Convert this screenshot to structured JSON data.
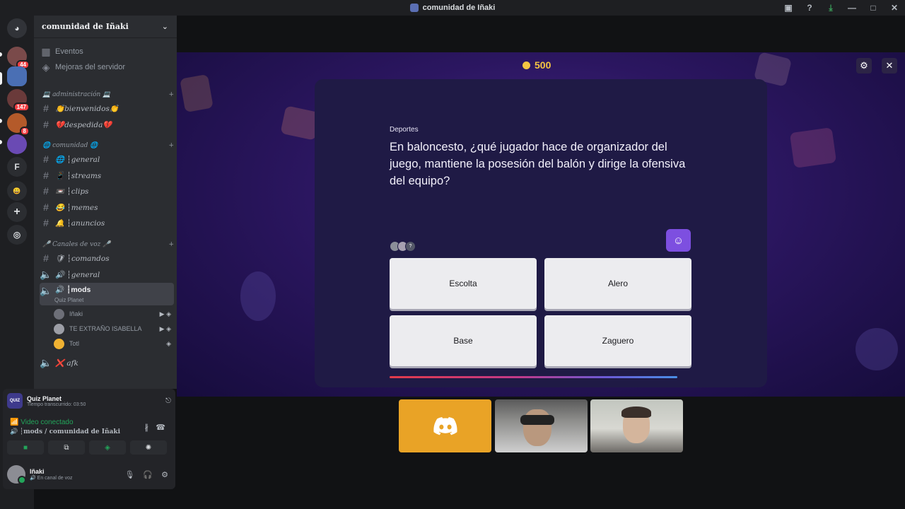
{
  "window": {
    "title": "comunidad de Iñaki"
  },
  "server": {
    "name": "comunidad de Iñaki"
  },
  "rail": {
    "badges": [
      "44",
      "147",
      "8"
    ],
    "letter": "F"
  },
  "sidebar": {
    "events": "Eventos",
    "boosts": "Mejoras del servidor",
    "categories": [
      {
        "label": "💻 administración 💻"
      },
      {
        "label": "🌐 comunidad 🌐"
      },
      {
        "label": "🎤 Canales de voz 🎤"
      }
    ],
    "admin_channels": [
      "👏bienvenidos👏",
      "💔despedida💔"
    ],
    "community_channels": [
      "🌐 ┆general",
      "📱 ┆streams",
      "📼 ┆clips",
      "😂 ┆memes",
      "🔔 ┆anuncios"
    ],
    "voice_channels": [
      "🛡 ┆comandos",
      "🔊 ┆general",
      "🔊 ┆mods",
      "❌ afk"
    ],
    "active_activity": "Quiz Planet",
    "voice_users": [
      "Iñaki",
      "TE EXTRAÑO ISABELLA",
      "Totl"
    ]
  },
  "activity_panel": {
    "app_name": "Quiz Planet",
    "elapsed": "Tiempo transcurrido: 03:50",
    "connection": "Video conectado",
    "channel": "mods / comunidad de Iñaki"
  },
  "user": {
    "name": "Iñaki",
    "status": "En canal de voz"
  },
  "quiz": {
    "coins": "500",
    "category": "Deportes",
    "question": "En baloncesto, ¿qué jugador hace de organizador del juego, mantiene la posesión del balón y dirige la ofensiva del equipo?",
    "answers": [
      "Escolta",
      "Alero",
      "Base",
      "Zaguero"
    ],
    "time_remaining": 0.98
  },
  "colors": {
    "accent": "#7d4fe0",
    "coin": "#f5c542",
    "online": "#23a55a",
    "tile": "#e9a326"
  }
}
